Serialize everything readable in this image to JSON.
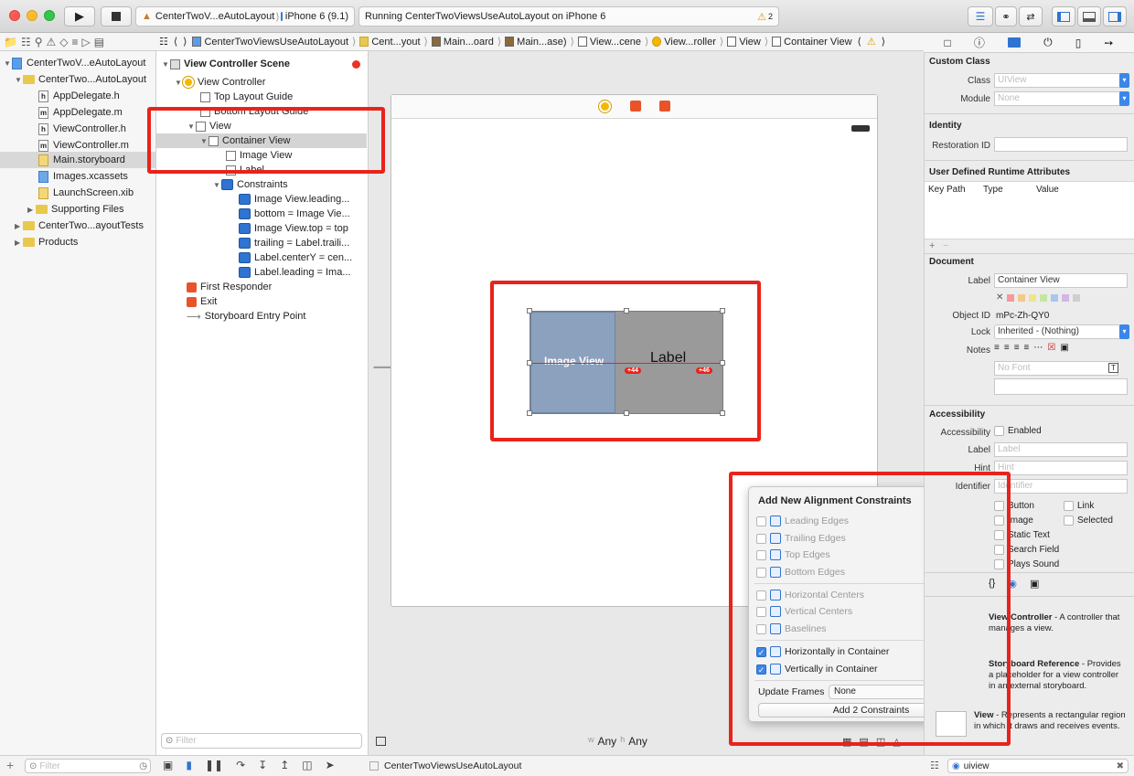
{
  "toolbar": {
    "scheme": "CenterTwoV...eAutoLayout",
    "device": "iPhone 6 (9.1)",
    "status": "Running CenterTwoViewsUseAutoLayout on iPhone 6",
    "warnings": "2"
  },
  "jumpbar": {
    "crumbs": [
      "CenterTwoViewsUseAutoLayout",
      "Cent...yout",
      "Main...oard",
      "Main...ase)",
      "View...cene",
      "View...roller",
      "View",
      "Container View"
    ]
  },
  "navigator": {
    "items": [
      {
        "label": "CenterTwoV...eAutoLayout",
        "icon": "project-icon"
      },
      {
        "label": "CenterTwo...AutoLayout",
        "icon": "folder-icon"
      },
      {
        "label": "AppDelegate.h",
        "icon": "h"
      },
      {
        "label": "AppDelegate.m",
        "icon": "m"
      },
      {
        "label": "ViewController.h",
        "icon": "h"
      },
      {
        "label": "ViewController.m",
        "icon": "m"
      },
      {
        "label": "Main.storyboard",
        "icon": "storyboard-icon"
      },
      {
        "label": "Images.xcassets",
        "icon": "assets-icon"
      },
      {
        "label": "LaunchScreen.xib",
        "icon": "xib-icon"
      },
      {
        "label": "Supporting Files",
        "icon": "folder-icon"
      },
      {
        "label": "CenterTwo...ayoutTests",
        "icon": "folder-icon"
      },
      {
        "label": "Products",
        "icon": "folder-icon"
      }
    ],
    "filter_placeholder": "Filter"
  },
  "outline": {
    "scene": "View Controller Scene",
    "rows": [
      "View Controller",
      "Top Layout Guide",
      "Bottom Layout Guide",
      "View",
      "Container View",
      "Image View",
      "Label",
      "Constraints",
      "Image View.leading...",
      "bottom = Image Vie...",
      "Image View.top = top",
      "trailing = Label.traili...",
      "Label.centerY = cen...",
      "Label.leading = Ima...",
      "First Responder",
      "Exit",
      "Storyboard Entry Point"
    ],
    "filter_placeholder": "Filter"
  },
  "canvas": {
    "image_view_label": "Image View",
    "label_text": "Label",
    "badge1": "+44",
    "badge2": "+46",
    "size_w": "Any",
    "size_h": "Any",
    "size_w_prefix": "w",
    "size_h_prefix": "h"
  },
  "popover": {
    "title": "Add New Alignment Constraints",
    "options": [
      {
        "label": "Leading Edges",
        "checked": false
      },
      {
        "label": "Trailing Edges",
        "checked": false
      },
      {
        "label": "Top Edges",
        "checked": false
      },
      {
        "label": "Bottom Edges",
        "checked": false
      },
      {
        "label": "Horizontal Centers",
        "checked": false
      },
      {
        "label": "Vertical Centers",
        "checked": false
      },
      {
        "label": "Baselines",
        "checked": false
      },
      {
        "label": "Horizontally in Container",
        "checked": true,
        "value": "0"
      },
      {
        "label": "Vertically in Container",
        "checked": true,
        "value": "0"
      }
    ],
    "update_frames_label": "Update Frames",
    "update_frames_value": "None",
    "add_button": "Add 2 Constraints"
  },
  "inspector": {
    "custom_class": "Custom Class",
    "class_label": "Class",
    "class_ph": "UIView",
    "module_label": "Module",
    "module_ph": "None",
    "identity": "Identity",
    "restoration_label": "Restoration ID",
    "udra": "User Defined Runtime Attributes",
    "col_keypath": "Key Path",
    "col_type": "Type",
    "col_value": "Value",
    "document": "Document",
    "doc_label": "Label",
    "doc_label_value": "Container View",
    "object_id_label": "Object ID",
    "object_id": "mPc-Zh-QY0",
    "lock_label": "Lock",
    "lock_value": "Inherited - (Nothing)",
    "notes_label": "Notes",
    "font_ph": "No Font",
    "accessibility": "Accessibility",
    "acc_label": "Accessibility",
    "acc_enabled": "Enabled",
    "acc_lab": "Label",
    "acc_lab_ph": "Label",
    "hint": "Hint",
    "hint_ph": "Hint",
    "identifier": "Identifier",
    "identifier_ph": "Identifier",
    "traits": [
      "Button",
      "Link",
      "Image",
      "Selected",
      "Static Text",
      "Search Field",
      "Plays Sound"
    ],
    "lib1_title": "View Controller",
    "lib1_desc": " - A controller that manages a view.",
    "lib2_title": "Storyboard Reference",
    "lib2_desc": " - Provides a placeholder for a view controller in an external storyboard.",
    "lib3_title": "View",
    "lib3_desc": " - Represents a rectangular region in which it draws and receives events.",
    "search_value": "uiview"
  },
  "bottombar": {
    "scheme_name": "CenterTwoViewsUseAutoLayout",
    "filter_placeholder": "Filter"
  },
  "colors": {
    "highlight": "#e8231b",
    "accent": "#2f74d0"
  }
}
